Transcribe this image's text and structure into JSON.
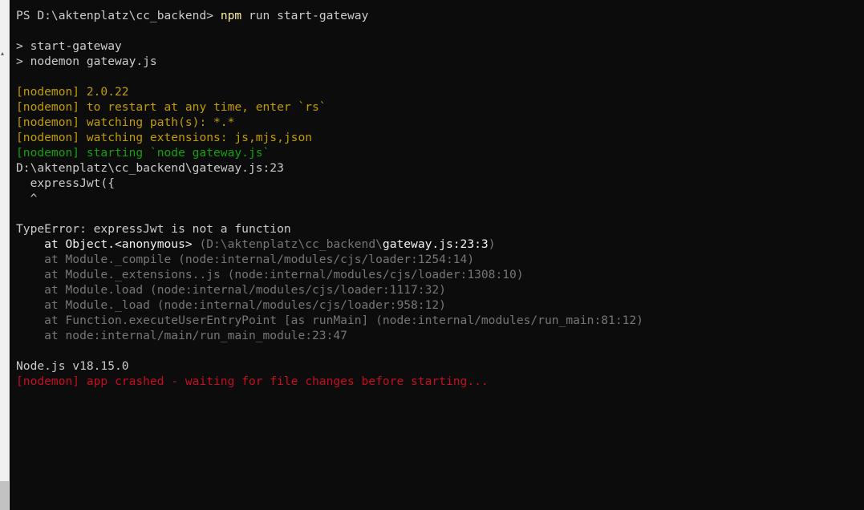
{
  "terminal": {
    "prompt": "PS D:\\aktenplatz\\cc_backend> ",
    "command": "npm",
    "command_args": " run start-gateway",
    "script_line": "> start-gateway",
    "script_cmd": "> nodemon gateway.js",
    "nodemon_lines": [
      "[nodemon] 2.0.22",
      "[nodemon] to restart at any time, enter `rs`",
      "[nodemon] watching path(s): *.*",
      "[nodemon] watching extensions: js,mjs,json"
    ],
    "nodemon_starting": "[nodemon] starting `node gateway.js`",
    "error_location": "D:\\aktenplatz\\cc_backend\\gateway.js:23",
    "error_source": "  expressJwt({",
    "error_caret": "  ^",
    "error_message": "TypeError: expressJwt is not a function",
    "stack_first": {
      "bright": "    at Object.<anonymous> ",
      "dim_path": "(D:\\aktenplatz\\cc_backend\\",
      "file": "gateway.js:23:3",
      "close": ")"
    },
    "stack_lines": [
      "    at Module._compile (node:internal/modules/cjs/loader:1254:14)",
      "    at Module._extensions..js (node:internal/modules/cjs/loader:1308:10)",
      "    at Module.load (node:internal/modules/cjs/loader:1117:32)",
      "    at Module._load (node:internal/modules/cjs/loader:958:12)",
      "    at Function.executeUserEntryPoint [as runMain] (node:internal/modules/run_main:81:12)",
      "    at node:internal/main/run_main_module:23:47"
    ],
    "node_version": "Node.js v18.15.0",
    "crash_message": "[nodemon] app crashed - waiting for file changes before starting..."
  },
  "colors": {
    "background": "#0c0c0c",
    "default_text": "#cccccc",
    "command": "#f9f1a5",
    "nodemon_info": "#c19c00",
    "nodemon_start": "#13a10e",
    "crash": "#c50f1f",
    "stack_dim": "#767676"
  }
}
